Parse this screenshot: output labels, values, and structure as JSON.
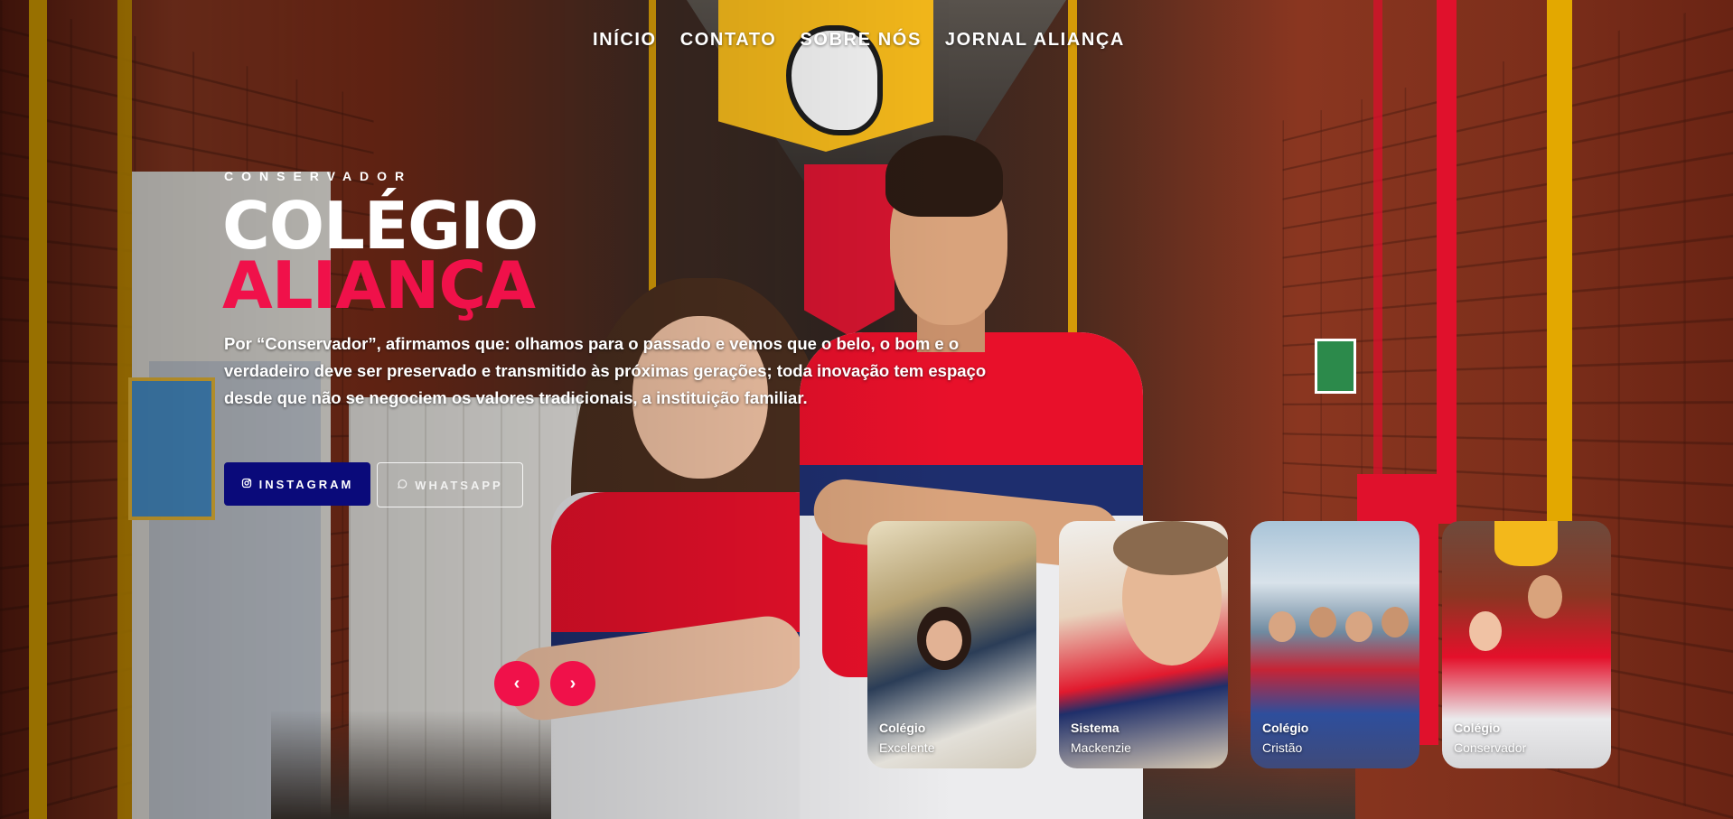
{
  "nav": {
    "items": [
      "INÍCIO",
      "CONTATO",
      "SOBRE NÓS",
      "JORNAL ALIANÇA"
    ]
  },
  "hero": {
    "eyebrow": "CONSERVADOR",
    "title_line1": "COLÉGIO",
    "title_line2": "ALIANÇA",
    "description": "Por “Conservador”, afirmamos que: olhamos para o passado e vemos que o belo, o bom e o verdadeiro deve ser preservado e transmitido às próximas gerações; toda inovação tem espaço desde que não se negociem os valores tradicionais, a instituição familiar.",
    "buttons": {
      "instagram": "INSTAGRAM",
      "whatsapp": "WHATSAPP"
    }
  },
  "slider": {
    "prev": "‹",
    "next": "›"
  },
  "thumbnails": [
    {
      "title": "Colégio",
      "subtitle": "Excelente"
    },
    {
      "title": "Sistema",
      "subtitle": "Mackenzie"
    },
    {
      "title": "Colégio",
      "subtitle": "Cristão"
    },
    {
      "title": "Colégio",
      "subtitle": "Conservador"
    }
  ],
  "colors": {
    "accent_pink": "#f0114a",
    "instagram_btn": "#0a0a7a",
    "uniform_red": "#e8102a",
    "uniform_navy": "#1e2e6e"
  },
  "icons": {
    "instagram": "instagram-icon",
    "whatsapp": "whatsapp-icon"
  }
}
